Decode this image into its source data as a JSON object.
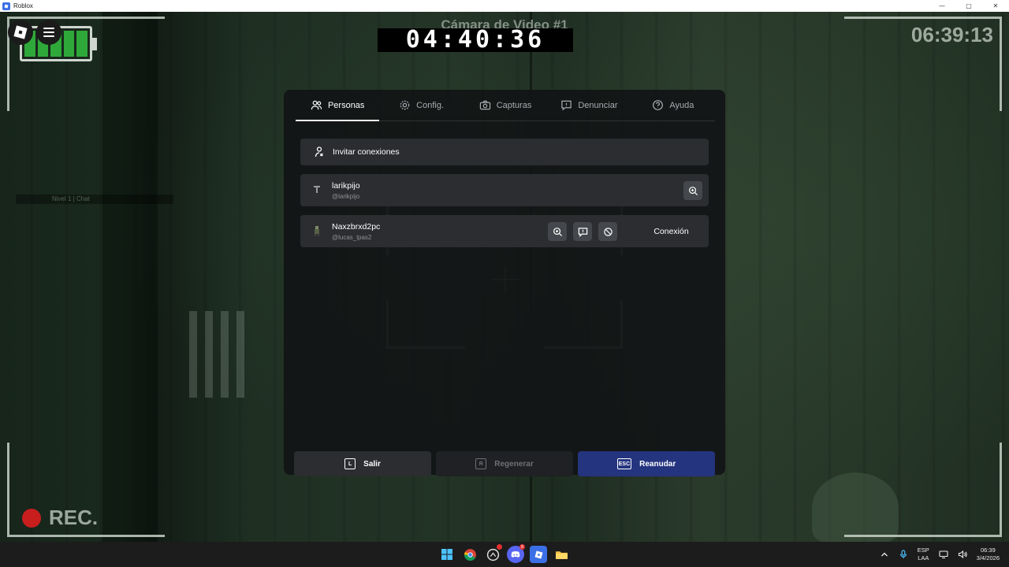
{
  "window": {
    "title": "Roblox",
    "controls": [
      "—",
      "▢",
      "✕"
    ]
  },
  "hud": {
    "camera_label": "Cámara de Video #1",
    "timer": "04:40:36",
    "clock": "06:39:13",
    "rec_label": "REC.",
    "battery_cells": 5,
    "sign_text": "Nivel 1  |  Chat"
  },
  "menu": {
    "tabs": [
      {
        "label": "Personas",
        "icon": "people-icon",
        "active": true
      },
      {
        "label": "Config.",
        "icon": "gear-icon",
        "active": false
      },
      {
        "label": "Capturas",
        "icon": "camera-icon",
        "active": false
      },
      {
        "label": "Denunciar",
        "icon": "report-icon",
        "active": false
      },
      {
        "label": "Ayuda",
        "icon": "help-icon",
        "active": false
      }
    ],
    "invite_label": "Invitar conexiones",
    "players": [
      {
        "name": "larikpijo",
        "handle": "@larikpijo",
        "actions": [
          "zoom-icon"
        ]
      },
      {
        "name": "Naxzbrxd2pc",
        "handle": "@lucas_lpas2",
        "actions": [
          "zoom-icon",
          "report-icon",
          "block-icon"
        ],
        "connect_label": "Conexión"
      }
    ],
    "buttons": {
      "exit": {
        "label": "Salir",
        "key": "L"
      },
      "reset": {
        "label": "Regenerar",
        "key": "R"
      },
      "resume": {
        "label": "Reanudar",
        "key": "ESC"
      }
    }
  },
  "taskbar": {
    "apps": [
      "windows-start-icon",
      "chrome-icon",
      "game-icon",
      "discord-icon",
      "roblox-icon",
      "file-explorer-icon"
    ],
    "discord_badge": "8",
    "language": "ESP",
    "layout": "LAA",
    "time": "06:39",
    "date": "3/4/2026"
  },
  "colors": {
    "battery": "#2fa83a",
    "rec": "#c81e1e",
    "resume_button": "#24347e",
    "panel": "#121416"
  }
}
